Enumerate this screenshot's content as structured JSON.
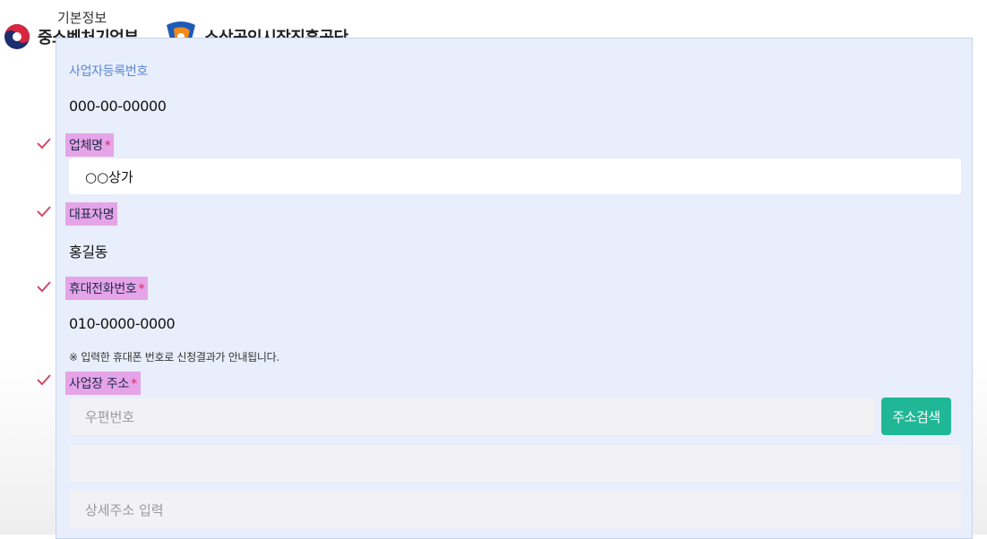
{
  "header": {
    "gov_subtitle": "기본정보",
    "gov_name": "중소벤처기업부",
    "agency_name": "소상공인시장진흥공단"
  },
  "form": {
    "business_number": {
      "label": "사업자등록번호",
      "value": "000-00-00000"
    },
    "company_name": {
      "label": "업체명",
      "required_mark": "*",
      "value": "○○상가"
    },
    "representative": {
      "label": "대표자명",
      "value": "홍길동"
    },
    "mobile": {
      "label": "휴대전화번호",
      "required_mark": "*",
      "value": "010-0000-0000",
      "note": "※ 입력한 휴대폰 번호로 신청결과가 안내됩니다."
    },
    "address": {
      "label": "사업장 주소",
      "required_mark": "*",
      "postal_placeholder": "우편번호",
      "search_button": "주소검색",
      "address_value": "",
      "detail_placeholder": "상세주소 입력"
    }
  },
  "colors": {
    "panel_bg": "#e8eefb",
    "highlight": "#e6a4e8",
    "check": "#d04a6a",
    "button": "#1fb796",
    "required": "#e0245e"
  },
  "icons": [
    "taegeuk-logo-icon",
    "semas-logo-icon",
    "checkmark-icon"
  ]
}
